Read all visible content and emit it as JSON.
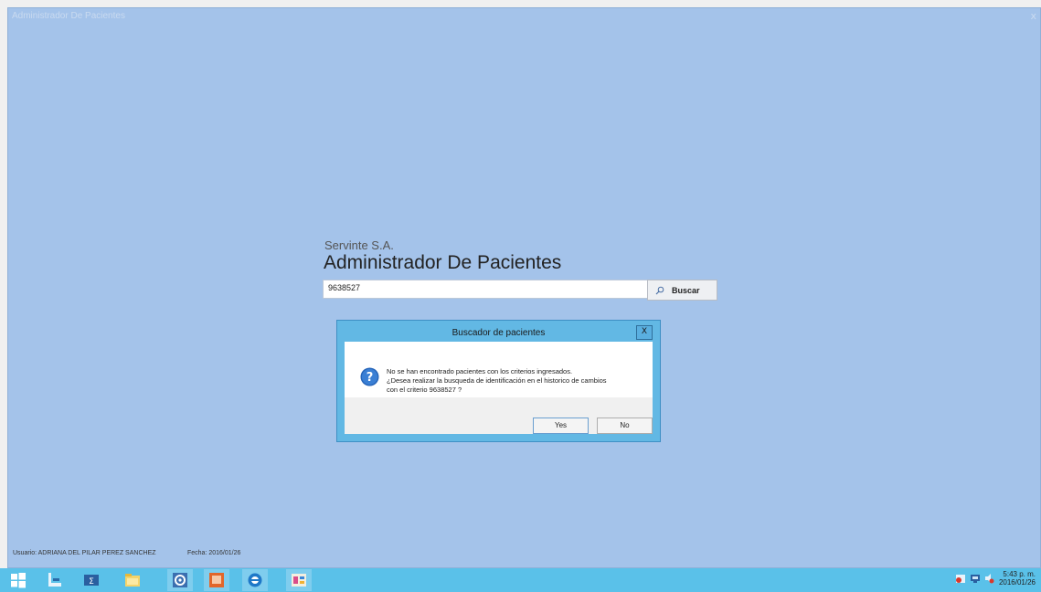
{
  "window": {
    "title": "Administrador De Pacientes",
    "close_glyph": "x"
  },
  "app": {
    "brand": "Servinte S.A.",
    "title": "Administrador De Pacientes"
  },
  "search": {
    "value": "9638527",
    "button_label": "Buscar",
    "icon": "search-icon"
  },
  "dialog": {
    "title": "Buscador de pacientes",
    "close_glyph": "X",
    "icon": "question-icon",
    "message_line1": "No se han encontrado pacientes con los criterios ingresados.",
    "message_line2": "¿Desea realizar la busqueda de identificación en el historico de cambios",
    "message_line3": "con el criterio 9638527 ?",
    "yes_label": "Yes",
    "no_label": "No"
  },
  "status": {
    "user_label": "Usuario: ADRIANA DEL PILAR PEREZ  SANCHEZ",
    "date_label": "Fecha: 2016/01/26"
  },
  "taskbar": {
    "items": [
      "windows-start-icon",
      "server-manager-icon",
      "powershell-icon",
      "file-explorer-icon",
      "settings-app-icon",
      "image-viewer-icon",
      "browser-icon",
      "app-window-icon"
    ],
    "clock_time": "5:43 p. m.",
    "clock_date": "2016/01/26",
    "colors": {
      "taskbar": "#5ac1e9",
      "desktop": "#a4c3ea",
      "dialog_frame": "#62b8e4"
    }
  }
}
